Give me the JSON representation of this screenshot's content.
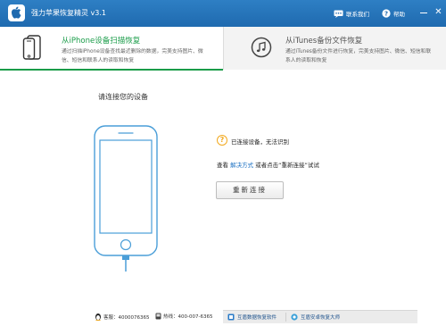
{
  "window": {
    "title": "强力苹果恢复精灵 v3.1",
    "contact_label": "联系我们",
    "help_label": "帮助",
    "close_glyph": "✕"
  },
  "tabs": [
    {
      "title": "从iPhone设备扫描恢复",
      "description": "通过扫描iPhone设备查找最近删除的数据，完美支持图片、微信、短信和联系人的读取和恢复",
      "active": true,
      "icon": "iphone-icon"
    },
    {
      "title": "从iTunes备份文件恢复",
      "description": "通过iTunes备份文件进行恢复，完美支持图片、微信、短信和联系人的读取和恢复",
      "active": false,
      "icon": "music-note-icon"
    }
  ],
  "main": {
    "heading": "请连接您的设备",
    "status_icon": "question-icon",
    "status_text": "已连接设备，无法识别",
    "hint_prefix": "查看",
    "hint_link": "解决方式",
    "hint_suffix": "或者点击“重新连接”试试",
    "reconnect_label": "重新连接"
  },
  "footer": {
    "qq_label": "客服：4000076365",
    "hotline_label": "热线：400-007-6365",
    "data_software_label": "互盾数据恢复软件",
    "master_label": "互盾安卓恢复大师"
  },
  "colors": {
    "titlebar": "#2473bb",
    "accent_green": "#1a9c49",
    "status_orange": "#f2a91e",
    "link_blue": "#1a6fc2"
  }
}
